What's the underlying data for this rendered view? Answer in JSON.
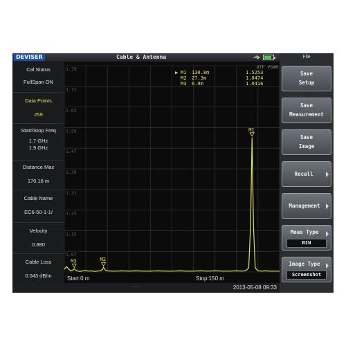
{
  "header": {
    "logo": "DEVISER",
    "title": "Cable & Antenna",
    "file_menu": "File",
    "battery_level": 0.85
  },
  "left_panel": {
    "cal_status_label": "Cal Status",
    "cal_status_value": "FullSpan ON",
    "data_points_label": "Data Points",
    "data_points_value": "259",
    "start_stop_label": "Start/Stop Freq",
    "start_freq": "1.7  GHz",
    "stop_freq": "1.9  GHz",
    "distance_max_label": "Distance Max",
    "distance_max_value": "170.16 m",
    "cable_name_label": "Cable Name",
    "cable_name_value": "EC6-50-1-1/",
    "velocity_label": "Velocity",
    "velocity_value": "0.880",
    "cable_loss_label": "Cable Loss",
    "cable_loss_value": "0.043 dB/m"
  },
  "plot": {
    "mode_label": "DTF VSWR",
    "y_ticks": [
      "1.79",
      "1.71",
      "1.63",
      "1.55",
      "1.47",
      "1.39",
      "1.31",
      "1.23",
      "1.15",
      "1.07"
    ],
    "start_label": "Start:0 m",
    "stop_label": "Stop:150 m",
    "marker_table": [
      {
        "active": "▶",
        "name": "M1",
        "distance": "130.8m",
        "value": "1.5253"
      },
      {
        "active": "",
        "name": "M2",
        "distance": "27.3m",
        "value": "1.0474"
      },
      {
        "active": "",
        "name": "M3",
        "distance": "6.9m",
        "value": "1.0416"
      }
    ],
    "marker_labels": [
      "M1",
      "M2",
      "M3"
    ]
  },
  "chart_data": {
    "type": "line",
    "title": "",
    "xlabel": "",
    "ylabel": "",
    "xlim": [
      0,
      150
    ],
    "ylim": [
      1.03,
      1.79
    ],
    "grid": true,
    "x": [
      0,
      1.5,
      3,
      4.5,
      5.5,
      6.3,
      6.9,
      7.5,
      8.3,
      9.5,
      11,
      13,
      15,
      17,
      19,
      21,
      23,
      24.5,
      25.8,
      26.6,
      27.3,
      28,
      28.8,
      30,
      33,
      36,
      40,
      45,
      50,
      55,
      60,
      65,
      70,
      75,
      80,
      85,
      90,
      95,
      100,
      105,
      110,
      115,
      120,
      124,
      126.5,
      128.5,
      129.8,
      130.8,
      131.8,
      133,
      135,
      138,
      140,
      143,
      146,
      150
    ],
    "series": [
      {
        "values": [
          1.04,
          1.05,
          1.041,
          1.034,
          1.036,
          1.039,
          1.0416,
          1.038,
          1.036,
          1.033,
          1.032,
          1.034,
          1.035,
          1.033,
          1.034,
          1.032,
          1.033,
          1.034,
          1.036,
          1.04,
          1.0474,
          1.041,
          1.036,
          1.034,
          1.033,
          1.033,
          1.034,
          1.033,
          1.034,
          1.033,
          1.033,
          1.034,
          1.033,
          1.033,
          1.034,
          1.033,
          1.033,
          1.034,
          1.033,
          1.034,
          1.033,
          1.033,
          1.034,
          1.033,
          1.035,
          1.045,
          1.2,
          1.5253,
          1.2,
          1.045,
          1.034,
          1.033,
          1.034,
          1.033,
          1.033,
          1.033
        ],
        "color": "#e3e35a"
      }
    ],
    "markers": [
      {
        "name": "M1",
        "x": 130.8,
        "y": 1.5253
      },
      {
        "name": "M2",
        "x": 27.3,
        "y": 1.0474
      },
      {
        "name": "M3",
        "x": 6.9,
        "y": 1.0416
      }
    ]
  },
  "bottom": {
    "dashes": "---",
    "timestamp": "2013-05-08 09:33"
  },
  "softkeys": {
    "save_setup": [
      "Save",
      "Setup"
    ],
    "save_measurement": [
      "Save",
      "Measurement"
    ],
    "save_image": [
      "Save",
      "Image"
    ],
    "recall": "Recall",
    "management": "Management",
    "meas_type": "Meas Type",
    "meas_type_value": "BIN",
    "image_type": "Image Type",
    "image_type_value": "Screenshot"
  },
  "colors": {
    "trace": "#e3e35a",
    "grid": "#3a3d3a",
    "background": "#0b0b0b"
  }
}
